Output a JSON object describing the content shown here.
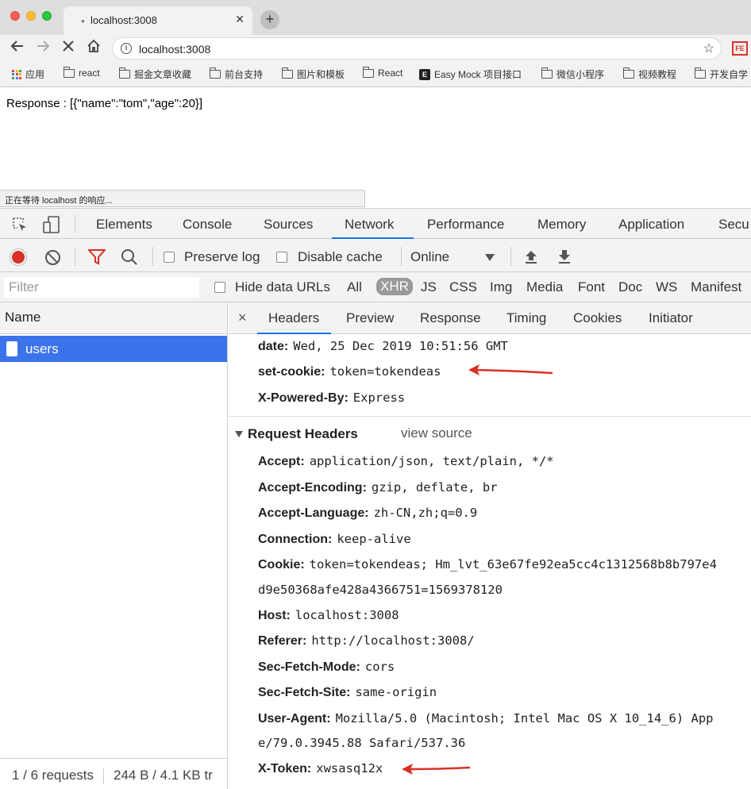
{
  "browser": {
    "tab_title": "localhost:3008",
    "tab_close": "✕",
    "new_tab": "+",
    "url": "localhost:3008",
    "ext_label": "FE"
  },
  "bookmarks": [
    {
      "label": "应用",
      "icon": "apps-grid-icon"
    },
    {
      "label": "react",
      "icon": "folder-icon"
    },
    {
      "label": "掘金文章收藏",
      "icon": "folder-icon"
    },
    {
      "label": "前台支持",
      "icon": "folder-icon"
    },
    {
      "label": "图片和模板",
      "icon": "folder-icon"
    },
    {
      "label": "React",
      "icon": "folder-icon"
    },
    {
      "label": "Easy Mock 项目接口",
      "icon": "easy-mock-icon"
    },
    {
      "label": "微信小程序",
      "icon": "folder-icon"
    },
    {
      "label": "视频教程",
      "icon": "folder-icon"
    },
    {
      "label": "开发自学",
      "icon": "folder-icon"
    }
  ],
  "page": {
    "response_text": "Response : [{\"name\":\"tom\",\"age\":20}]",
    "status_bubble": "正在等待 localhost 的响应..."
  },
  "devtools": {
    "tabs": [
      "Elements",
      "Console",
      "Sources",
      "Network",
      "Performance",
      "Memory",
      "Application",
      "Secu"
    ],
    "active_tab": "Network",
    "toolbar": {
      "preserve_log": "Preserve log",
      "disable_cache": "Disable cache",
      "throttling": "Online"
    },
    "filter": {
      "placeholder": "Filter",
      "hide_data_urls": "Hide data URLs",
      "types": [
        "All",
        "XHR",
        "JS",
        "CSS",
        "Img",
        "Media",
        "Font",
        "Doc",
        "WS",
        "Manifest"
      ],
      "active_type": "XHR"
    },
    "name_column": {
      "header": "Name",
      "requests": [
        "users"
      ],
      "summary_requests": "1 / 6 requests",
      "summary_size": "244 B / 4.1 KB tr"
    },
    "detail": {
      "close": "×",
      "tabs": [
        "Headers",
        "Preview",
        "Response",
        "Timing",
        "Cookies",
        "Initiator"
      ],
      "active_tab": "Headers",
      "response_headers": [
        {
          "key": "date:",
          "value": "Wed, 25 Dec 2019 10:51:56 GMT"
        },
        {
          "key": "set-cookie:",
          "value": "token=tokendeas"
        },
        {
          "key": "X-Powered-By:",
          "value": "Express"
        }
      ],
      "request_headers_title": "Request Headers",
      "view_source": "view source",
      "request_headers": [
        {
          "key": "Accept:",
          "value": "application/json, text/plain, */*"
        },
        {
          "key": "Accept-Encoding:",
          "value": "gzip, deflate, br"
        },
        {
          "key": "Accept-Language:",
          "value": "zh-CN,zh;q=0.9"
        },
        {
          "key": "Connection:",
          "value": "keep-alive"
        },
        {
          "key": "Cookie:",
          "value": "token=tokendeas; Hm_lvt_63e67fe92ea5cc4c1312568b8b797e4",
          "cont": "d9e50368afe428a4366751=1569378120"
        },
        {
          "key": "Host:",
          "value": "localhost:3008"
        },
        {
          "key": "Referer:",
          "value": "http://localhost:3008/"
        },
        {
          "key": "Sec-Fetch-Mode:",
          "value": "cors"
        },
        {
          "key": "Sec-Fetch-Site:",
          "value": "same-origin"
        },
        {
          "key": "User-Agent:",
          "value": "Mozilla/5.0 (Macintosh; Intel Mac OS X 10_14_6) App",
          "cont": "e/79.0.3945.88 Safari/537.36"
        },
        {
          "key": "X-Token:",
          "value": "xwsasq12x"
        }
      ]
    }
  },
  "colors": {
    "accent": "#1a73e8",
    "selected_row": "#3b73ea",
    "annotation_arrow": "#d93025"
  }
}
